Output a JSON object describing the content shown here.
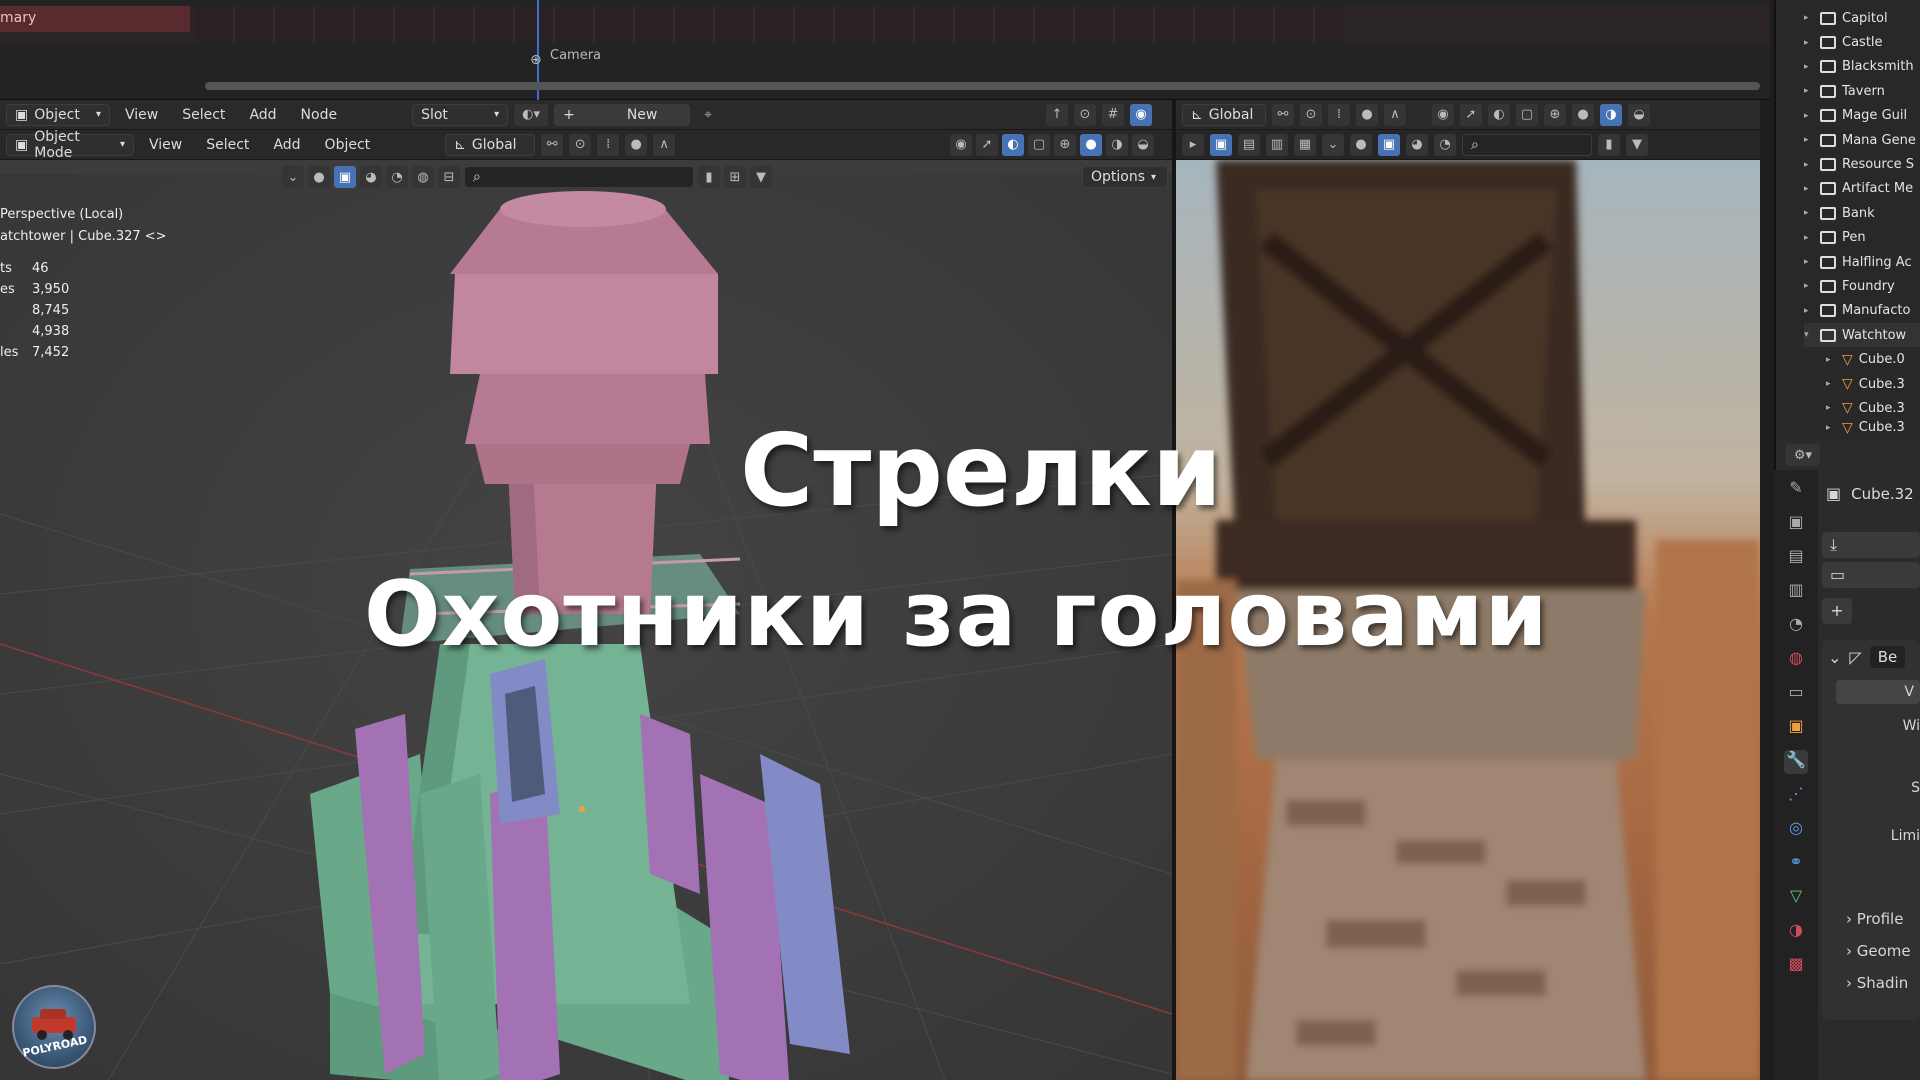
{
  "timeline": {
    "strip_label": "mary",
    "camera_label": "Camera"
  },
  "shader_header": {
    "editor": "Object",
    "menu": [
      "View",
      "Select",
      "Add",
      "Node"
    ],
    "slot": "Slot",
    "new_label": "New"
  },
  "viewport_header": {
    "mode": "Object Mode",
    "menu": [
      "View",
      "Select",
      "Add",
      "Object"
    ],
    "orientation": "Global",
    "options_label": "Options"
  },
  "right_header": {
    "orientation": "Global"
  },
  "viewport_info": {
    "view_name": "Perspective (Local)",
    "object_path": "atchtower | Cube.327 <>",
    "stats": [
      {
        "label": "ts",
        "value": "46"
      },
      {
        "label": "es",
        "value": "3,950"
      },
      {
        "label": "",
        "value": "8,745"
      },
      {
        "label": "",
        "value": "4,938"
      },
      {
        "label": "les",
        "value": "7,452"
      }
    ]
  },
  "outliner": {
    "items": [
      {
        "label": "Capitol",
        "kind": "collection"
      },
      {
        "label": "Castle",
        "kind": "collection"
      },
      {
        "label": "Blacksmith",
        "kind": "collection"
      },
      {
        "label": "Tavern",
        "kind": "collection"
      },
      {
        "label": "Mage Guil",
        "kind": "collection"
      },
      {
        "label": "Mana Gene",
        "kind": "collection"
      },
      {
        "label": "Resource S",
        "kind": "collection"
      },
      {
        "label": "Artifact Me",
        "kind": "collection"
      },
      {
        "label": "Bank",
        "kind": "collection"
      },
      {
        "label": "Pen",
        "kind": "collection"
      },
      {
        "label": "Halfling Ac",
        "kind": "collection"
      },
      {
        "label": "Foundry",
        "kind": "collection"
      },
      {
        "label": "Manufacto",
        "kind": "collection"
      },
      {
        "label": "Watchtow",
        "kind": "collection-open"
      },
      {
        "label": "Cube.0",
        "kind": "mesh"
      },
      {
        "label": "Cube.3",
        "kind": "mesh"
      },
      {
        "label": "Cube.3",
        "kind": "mesh"
      },
      {
        "label": "Cube.3",
        "kind": "mesh"
      }
    ]
  },
  "properties": {
    "object_name": "Cube.32",
    "modifier_name": "Be",
    "rows": [
      "V",
      "Wi",
      "S",
      "Limi"
    ],
    "panels": [
      "Profile",
      "Geome",
      "Shadin"
    ]
  },
  "overlay": {
    "line1": "Стрелки",
    "line2": "Охотники за головами"
  },
  "logo": {
    "text": "POLYROAD"
  },
  "colors": {
    "accent": "#4772b3",
    "timeline_strip": "#5a2b2e",
    "mesh_green": "#6aa88a",
    "mesh_pink": "#b67a94",
    "mesh_purple": "#9a6ab0",
    "mesh_blue": "#7f86c0"
  }
}
